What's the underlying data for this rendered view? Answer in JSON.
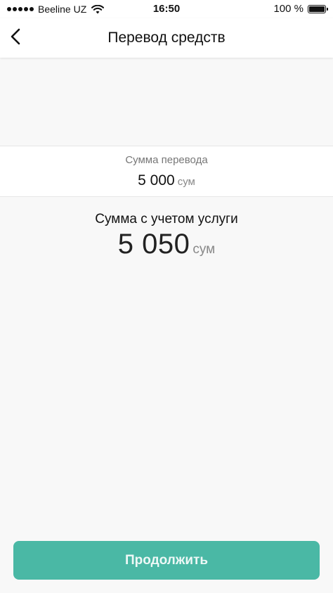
{
  "status_bar": {
    "carrier": "Beeline UZ",
    "time": "16:50",
    "battery": "100 %",
    "icons": [
      "signal-icon",
      "wifi-icon",
      "battery-icon"
    ]
  },
  "nav": {
    "title": "Перевод средств",
    "back_icon": "chevron-left-icon"
  },
  "transfer": {
    "label": "Сумма перевода",
    "value": "5 000",
    "currency": "сум"
  },
  "total": {
    "label": "Сумма с учетом услуги",
    "value": "5 050",
    "currency": "сум"
  },
  "actions": {
    "continue_label": "Продолжить"
  },
  "colors": {
    "accent": "#4ab8a5",
    "background": "#f8f8f8"
  }
}
